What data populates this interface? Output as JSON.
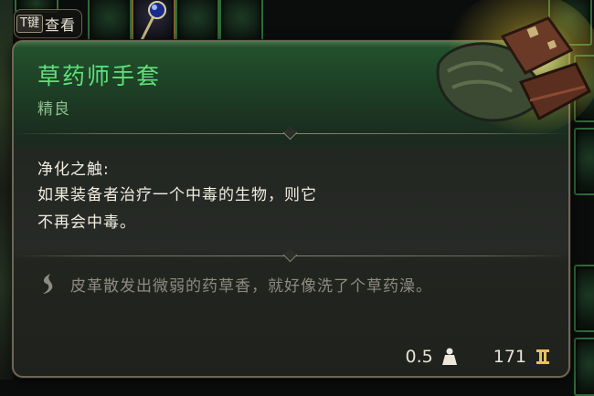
{
  "hint": {
    "key": "T键",
    "label": "查看"
  },
  "item": {
    "name": "草药师手套",
    "rarity": "精良",
    "passive_name": "净化之触:",
    "passive_lines": [
      "如果装备者治疗一个中毒的生物，则它",
      "不再会中毒。"
    ],
    "flavor": "皮革散发出微弱的药草香，就好像洗了个草药澡。",
    "weight": "0.5",
    "value": "171"
  },
  "colors": {
    "title": "#5fe07a",
    "rarity": "#8fbf8e",
    "body_text": "#f1ede1",
    "flavor_text": "#8e8b82",
    "border": "#6e6656"
  },
  "icons": [
    "quill-icon",
    "weight-icon",
    "gold-coin-icon",
    "gloves-item-icon"
  ]
}
